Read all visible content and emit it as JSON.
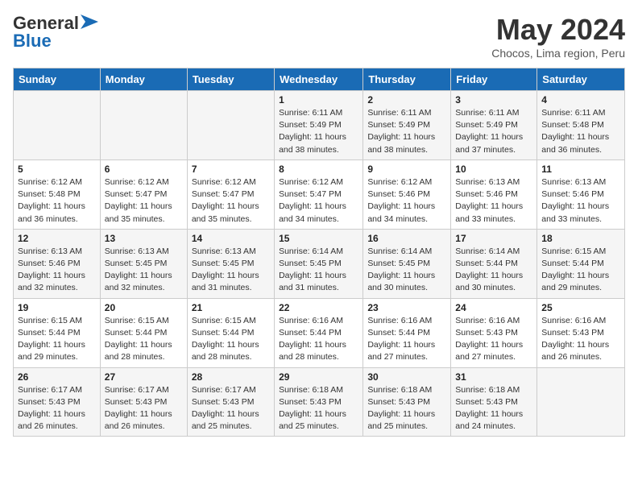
{
  "logo": {
    "line1": "General",
    "line2": "Blue"
  },
  "title": "May 2024",
  "location": "Chocos, Lima region, Peru",
  "weekdays": [
    "Sunday",
    "Monday",
    "Tuesday",
    "Wednesday",
    "Thursday",
    "Friday",
    "Saturday"
  ],
  "weeks": [
    [
      {
        "day": "",
        "info": ""
      },
      {
        "day": "",
        "info": ""
      },
      {
        "day": "",
        "info": ""
      },
      {
        "day": "1",
        "info": "Sunrise: 6:11 AM\nSunset: 5:49 PM\nDaylight: 11 hours\nand 38 minutes."
      },
      {
        "day": "2",
        "info": "Sunrise: 6:11 AM\nSunset: 5:49 PM\nDaylight: 11 hours\nand 38 minutes."
      },
      {
        "day": "3",
        "info": "Sunrise: 6:11 AM\nSunset: 5:49 PM\nDaylight: 11 hours\nand 37 minutes."
      },
      {
        "day": "4",
        "info": "Sunrise: 6:11 AM\nSunset: 5:48 PM\nDaylight: 11 hours\nand 36 minutes."
      }
    ],
    [
      {
        "day": "5",
        "info": "Sunrise: 6:12 AM\nSunset: 5:48 PM\nDaylight: 11 hours\nand 36 minutes."
      },
      {
        "day": "6",
        "info": "Sunrise: 6:12 AM\nSunset: 5:47 PM\nDaylight: 11 hours\nand 35 minutes."
      },
      {
        "day": "7",
        "info": "Sunrise: 6:12 AM\nSunset: 5:47 PM\nDaylight: 11 hours\nand 35 minutes."
      },
      {
        "day": "8",
        "info": "Sunrise: 6:12 AM\nSunset: 5:47 PM\nDaylight: 11 hours\nand 34 minutes."
      },
      {
        "day": "9",
        "info": "Sunrise: 6:12 AM\nSunset: 5:46 PM\nDaylight: 11 hours\nand 34 minutes."
      },
      {
        "day": "10",
        "info": "Sunrise: 6:13 AM\nSunset: 5:46 PM\nDaylight: 11 hours\nand 33 minutes."
      },
      {
        "day": "11",
        "info": "Sunrise: 6:13 AM\nSunset: 5:46 PM\nDaylight: 11 hours\nand 33 minutes."
      }
    ],
    [
      {
        "day": "12",
        "info": "Sunrise: 6:13 AM\nSunset: 5:46 PM\nDaylight: 11 hours\nand 32 minutes."
      },
      {
        "day": "13",
        "info": "Sunrise: 6:13 AM\nSunset: 5:45 PM\nDaylight: 11 hours\nand 32 minutes."
      },
      {
        "day": "14",
        "info": "Sunrise: 6:13 AM\nSunset: 5:45 PM\nDaylight: 11 hours\nand 31 minutes."
      },
      {
        "day": "15",
        "info": "Sunrise: 6:14 AM\nSunset: 5:45 PM\nDaylight: 11 hours\nand 31 minutes."
      },
      {
        "day": "16",
        "info": "Sunrise: 6:14 AM\nSunset: 5:45 PM\nDaylight: 11 hours\nand 30 minutes."
      },
      {
        "day": "17",
        "info": "Sunrise: 6:14 AM\nSunset: 5:44 PM\nDaylight: 11 hours\nand 30 minutes."
      },
      {
        "day": "18",
        "info": "Sunrise: 6:15 AM\nSunset: 5:44 PM\nDaylight: 11 hours\nand 29 minutes."
      }
    ],
    [
      {
        "day": "19",
        "info": "Sunrise: 6:15 AM\nSunset: 5:44 PM\nDaylight: 11 hours\nand 29 minutes."
      },
      {
        "day": "20",
        "info": "Sunrise: 6:15 AM\nSunset: 5:44 PM\nDaylight: 11 hours\nand 28 minutes."
      },
      {
        "day": "21",
        "info": "Sunrise: 6:15 AM\nSunset: 5:44 PM\nDaylight: 11 hours\nand 28 minutes."
      },
      {
        "day": "22",
        "info": "Sunrise: 6:16 AM\nSunset: 5:44 PM\nDaylight: 11 hours\nand 28 minutes."
      },
      {
        "day": "23",
        "info": "Sunrise: 6:16 AM\nSunset: 5:44 PM\nDaylight: 11 hours\nand 27 minutes."
      },
      {
        "day": "24",
        "info": "Sunrise: 6:16 AM\nSunset: 5:43 PM\nDaylight: 11 hours\nand 27 minutes."
      },
      {
        "day": "25",
        "info": "Sunrise: 6:16 AM\nSunset: 5:43 PM\nDaylight: 11 hours\nand 26 minutes."
      }
    ],
    [
      {
        "day": "26",
        "info": "Sunrise: 6:17 AM\nSunset: 5:43 PM\nDaylight: 11 hours\nand 26 minutes."
      },
      {
        "day": "27",
        "info": "Sunrise: 6:17 AM\nSunset: 5:43 PM\nDaylight: 11 hours\nand 26 minutes."
      },
      {
        "day": "28",
        "info": "Sunrise: 6:17 AM\nSunset: 5:43 PM\nDaylight: 11 hours\nand 25 minutes."
      },
      {
        "day": "29",
        "info": "Sunrise: 6:18 AM\nSunset: 5:43 PM\nDaylight: 11 hours\nand 25 minutes."
      },
      {
        "day": "30",
        "info": "Sunrise: 6:18 AM\nSunset: 5:43 PM\nDaylight: 11 hours\nand 25 minutes."
      },
      {
        "day": "31",
        "info": "Sunrise: 6:18 AM\nSunset: 5:43 PM\nDaylight: 11 hours\nand 24 minutes."
      },
      {
        "day": "",
        "info": ""
      }
    ]
  ]
}
